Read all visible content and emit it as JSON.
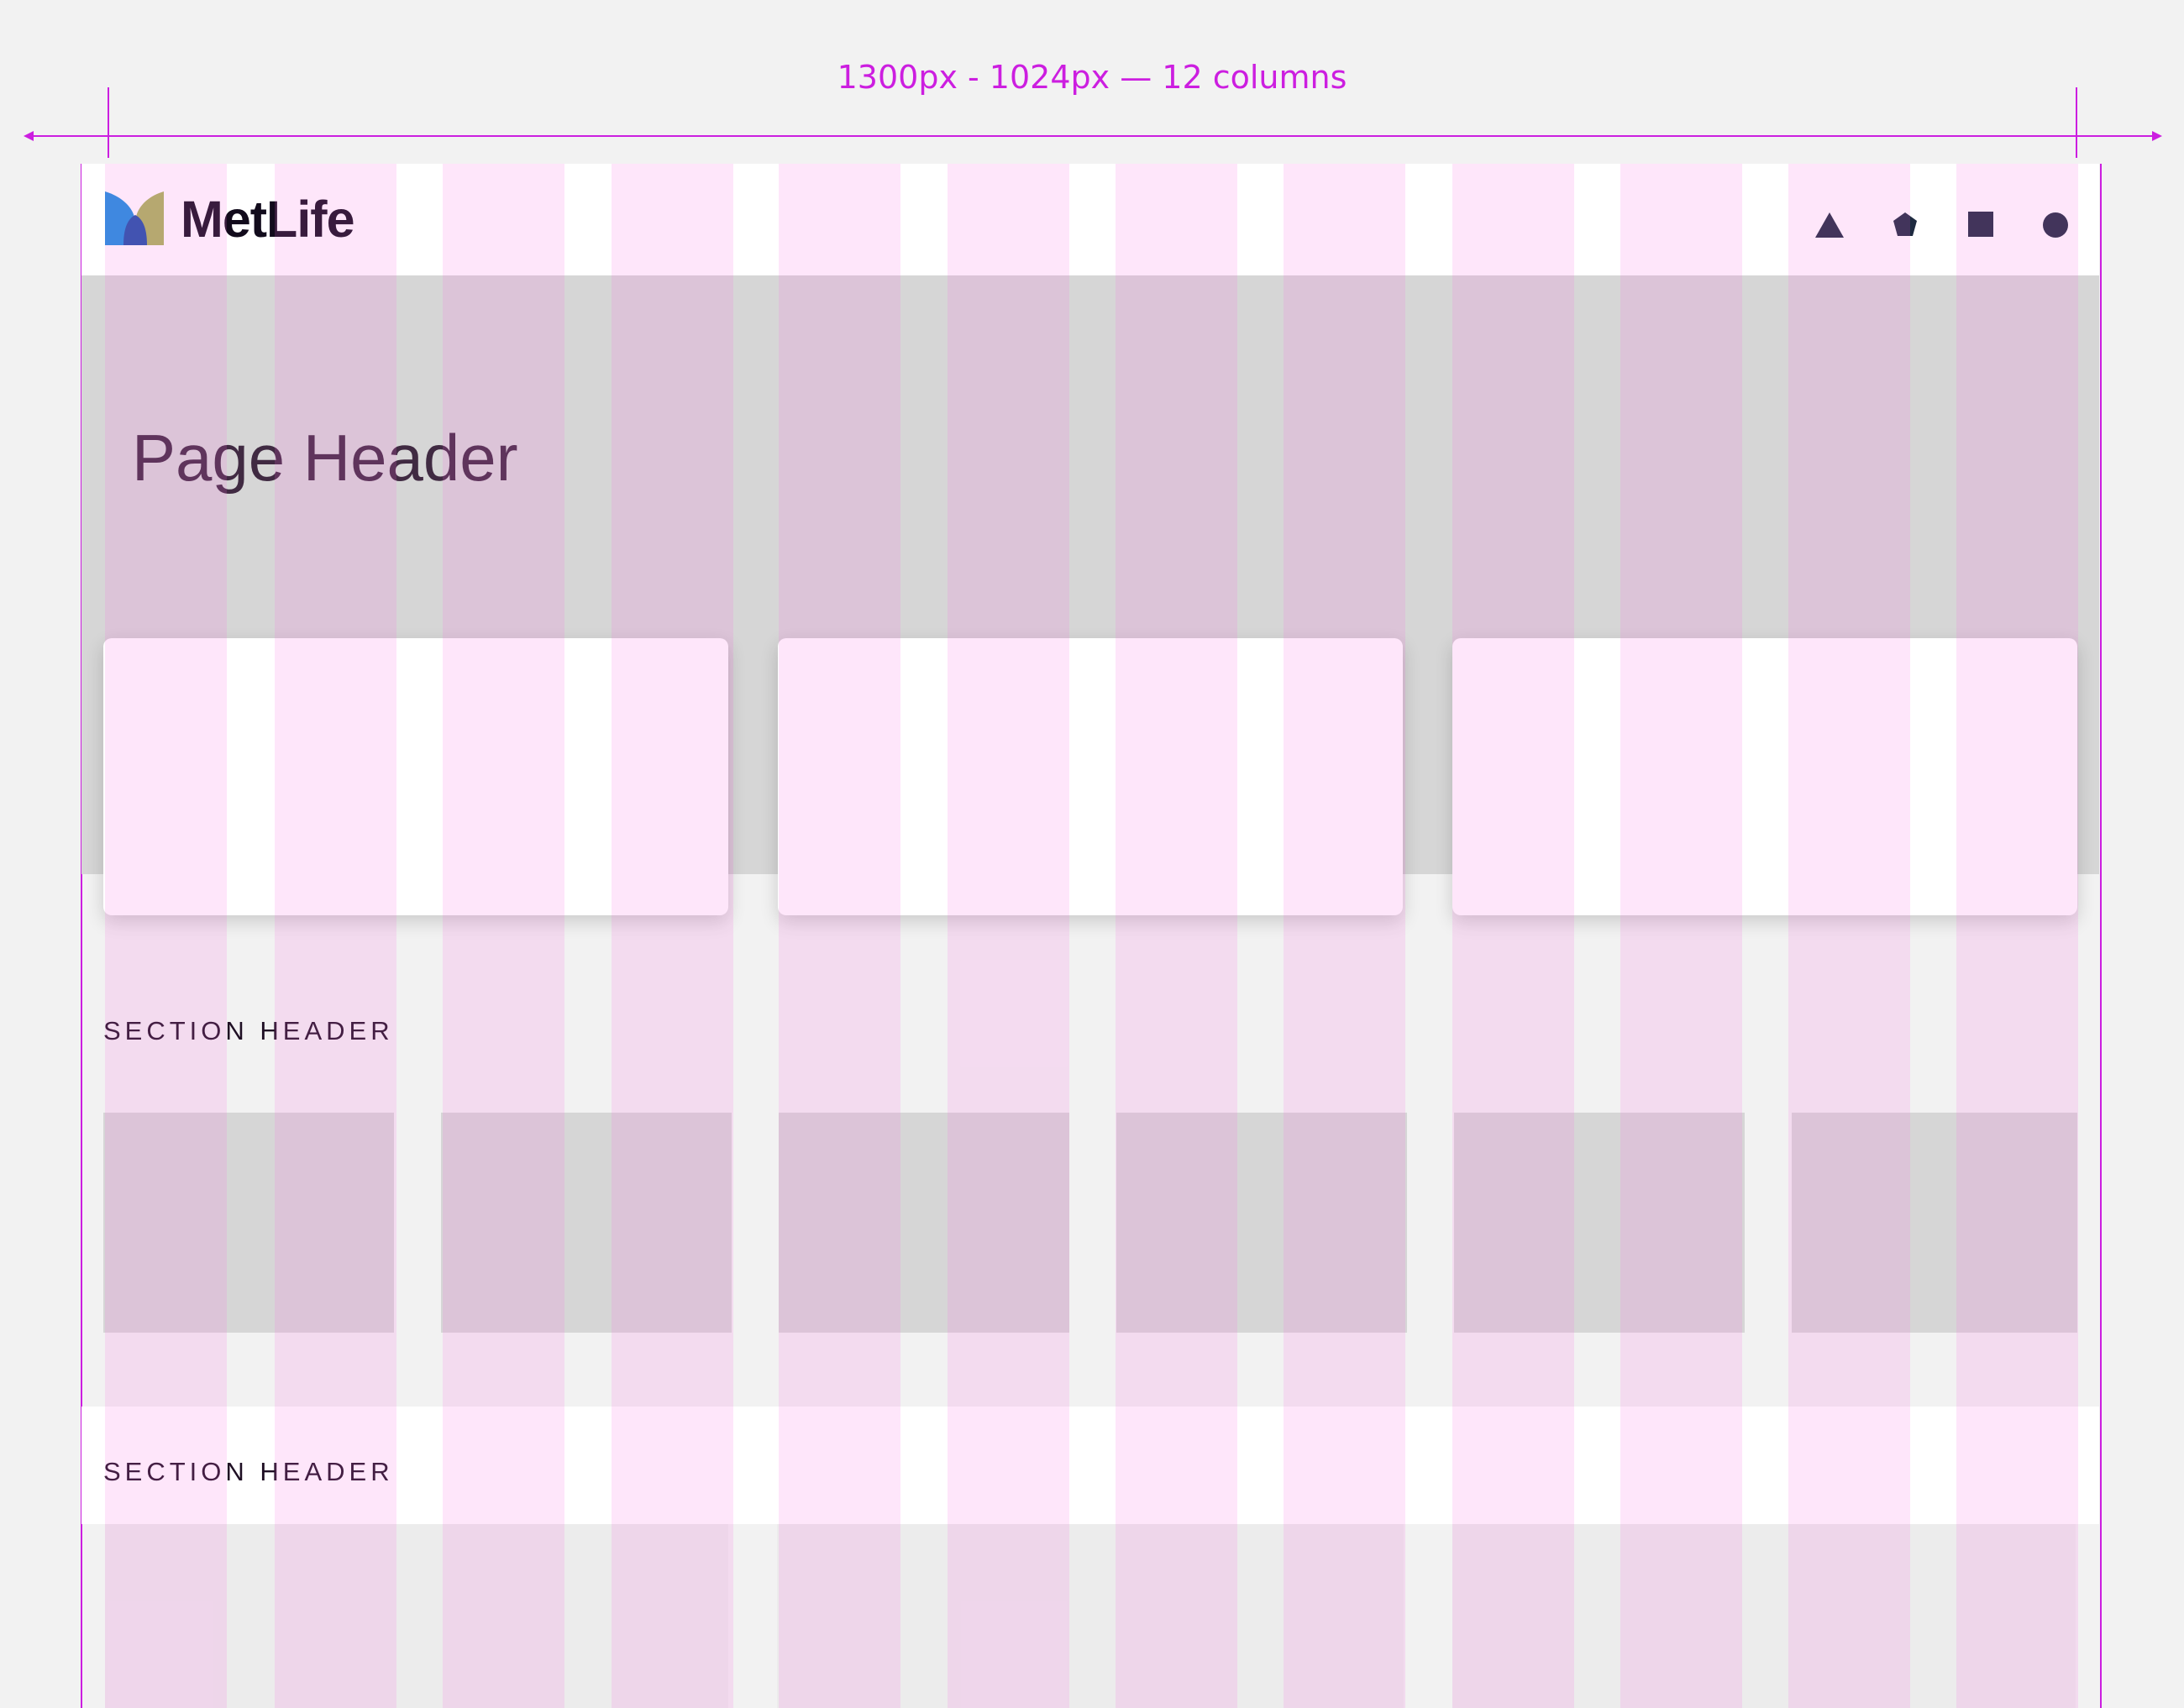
{
  "annotation": {
    "measure_label": "1300px - 1024px — 12 columns",
    "grid_columns": 12,
    "guide_color": "#cc1ee0",
    "column_overlay_color": "#fc6ce4"
  },
  "nav": {
    "brand_name": "MetLife",
    "logo_colors": [
      "#1a8fe0",
      "#a9b55a",
      "#1d4fa8"
    ],
    "icons": [
      "triangle-icon",
      "pentagon-icon",
      "square-icon",
      "circle-icon"
    ],
    "icon_color": "#1e2a40"
  },
  "hero": {
    "page_title": "Page Header"
  },
  "sections": [
    {
      "header": "SECTION HEADER"
    },
    {
      "header": "SECTION HEADER"
    }
  ]
}
